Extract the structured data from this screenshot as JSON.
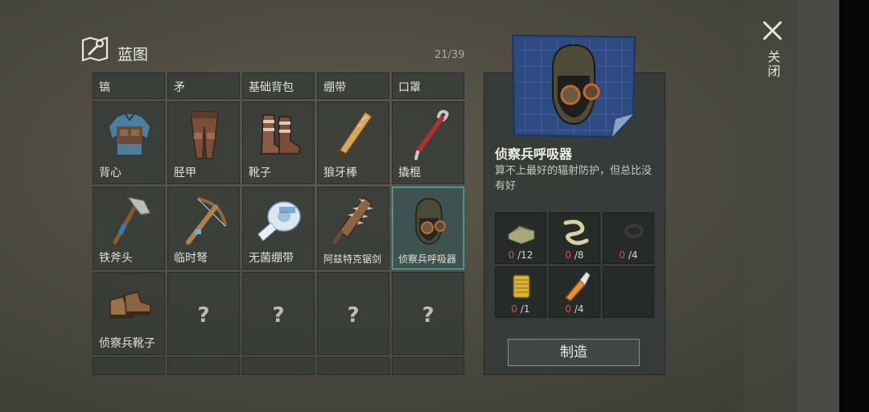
{
  "header": {
    "title": "蓝图",
    "count": "21/39"
  },
  "close": {
    "label": "关闭"
  },
  "grid": {
    "row0": [
      "镐",
      "矛",
      "基础背包",
      "绷带",
      "口罩"
    ],
    "row1": [
      "背心",
      "胫甲",
      "靴子",
      "狼牙棒",
      "撬棍"
    ],
    "row2": [
      "铁斧头",
      "临时弩",
      "无菌绷带",
      "阿兹特克锯剑",
      "侦察兵呼吸器"
    ],
    "row3": [
      "侦察兵靴子",
      "?",
      "?",
      "?",
      "?"
    ]
  },
  "detail": {
    "name": "侦察兵呼吸器",
    "description": "算不上最好的辐射防护，但总比没有好",
    "materials": [
      {
        "have": "0",
        "need": "/12",
        "icon": "cloth-icon"
      },
      {
        "have": "0",
        "need": "/8",
        "icon": "rope-icon"
      },
      {
        "have": "0",
        "need": "/4",
        "icon": "rubber-ring-icon"
      },
      {
        "have": "0",
        "need": "/1",
        "icon": "filter-icon"
      },
      {
        "have": "0",
        "need": "/4",
        "icon": "glue-icon"
      }
    ],
    "craft_label": "制造"
  },
  "colors": {
    "selected_border": "#5fa0a0",
    "missing_qty": "#e05045"
  }
}
